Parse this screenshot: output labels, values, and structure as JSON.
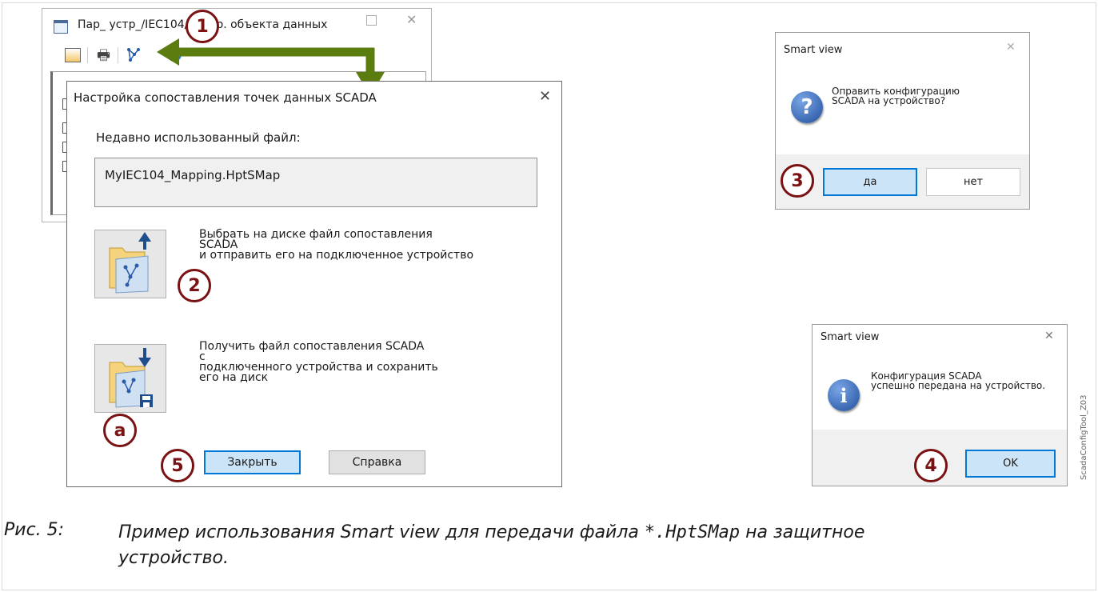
{
  "bg_window": {
    "title": "Пар_ устр_/IEC104/Настр. объекта данных"
  },
  "main_dialog": {
    "title": "Настройка сопоставления точек данных SCADA",
    "recent_label": "Недавно использованный файл:",
    "recent_file": "MyIEC104_Mapping.HptSMap",
    "send_text": [
      "Выбрать на диске файл сопоставления",
      "SCADA",
      "и отправить его на подключенное устройство"
    ],
    "receive_text": [
      "Получить файл сопоставления SCADA",
      "с",
      "подключенного устройства и сохранить",
      "его на диск"
    ],
    "close_label": "Закрыть",
    "help_label": "Справка"
  },
  "confirm_dialog": {
    "title": "Smart view",
    "message": [
      "Оправить конфигурацию",
      "SCADA на устройство?"
    ],
    "yes_label": "да",
    "no_label": "нет"
  },
  "info_dialog": {
    "title": "Smart view",
    "message": [
      "Конфигурация SCADA",
      "успешно передана на устройство."
    ],
    "ok_label": "OK"
  },
  "callouts": {
    "c1": "1",
    "c2": "2",
    "c3": "3",
    "c4": "4",
    "c5": "5",
    "ca": "a"
  },
  "side_label": "ScadaConfigTool_Z03",
  "caption": {
    "number": "Рис. 5:",
    "line1_prefix": "Пример использования Smart view для передачи файла ",
    "file_mask": "*.HptSMap",
    "line1_suffix": " на защитное",
    "line2": "устройство."
  },
  "colors": {
    "arrow": "#5b7d0f",
    "callout": "#7a1113",
    "accent": "#0078d7"
  }
}
